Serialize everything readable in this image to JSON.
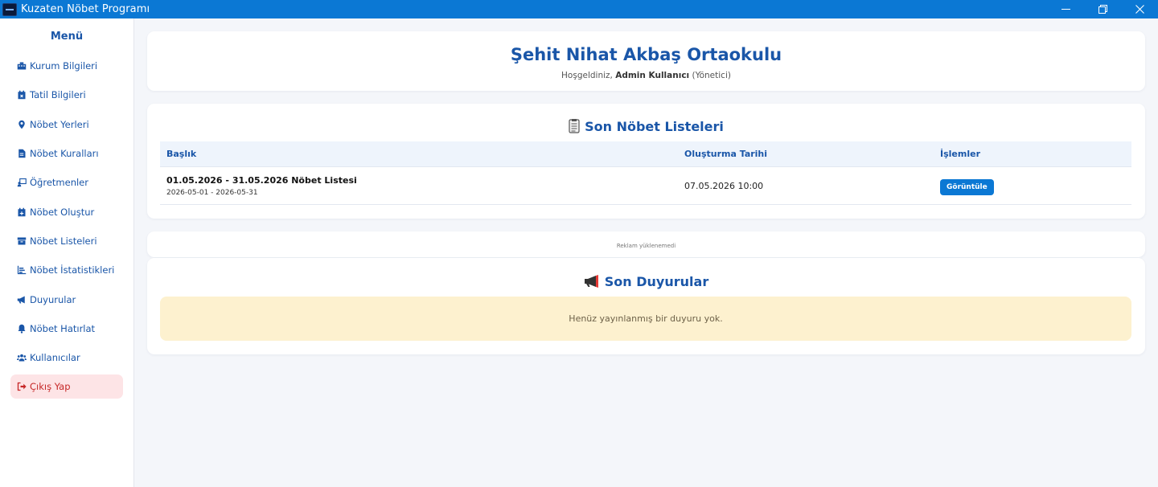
{
  "window": {
    "title": "Kuzaten Nöbet Programı"
  },
  "sidebar": {
    "title": "Menü",
    "items": [
      {
        "label": "Kurum Bilgileri",
        "icon": "building-icon"
      },
      {
        "label": "Tatil Bilgileri",
        "icon": "calendar-x-icon"
      },
      {
        "label": "Nöbet Yerleri",
        "icon": "map-pin-icon"
      },
      {
        "label": "Nöbet Kuralları",
        "icon": "file-icon"
      },
      {
        "label": "Öğretmenler",
        "icon": "teacher-icon"
      },
      {
        "label": "Nöbet Oluştur",
        "icon": "calendar-plus-icon"
      },
      {
        "label": "Nöbet Listeleri",
        "icon": "archive-icon"
      },
      {
        "label": "Nöbet İstatistikleri",
        "icon": "chart-icon"
      },
      {
        "label": "Duyurular",
        "icon": "megaphone-icon"
      },
      {
        "label": "Nöbet Hatırlat",
        "icon": "bell-icon"
      },
      {
        "label": "Kullanıcılar",
        "icon": "users-icon"
      }
    ],
    "logout": {
      "label": "Çıkış Yap",
      "icon": "sign-out-icon"
    }
  },
  "header": {
    "school_name": "Şehit Nihat Akbaş Ortaokulu",
    "welcome_prefix": "Hoşgeldiniz,",
    "user_name": "Admin Kullanıcı",
    "role": "(Yönetici)"
  },
  "recent_lists": {
    "title": "Son Nöbet Listeleri",
    "columns": {
      "title": "Başlık",
      "created": "Oluşturma Tarihi",
      "actions": "İşlemler"
    },
    "rows": [
      {
        "title": "01.05.2026 - 31.05.2026 Nöbet Listesi",
        "range": "2026-05-01 - 2026-05-31",
        "created": "07.05.2026 10:00",
        "action_label": "Görüntüle"
      }
    ]
  },
  "ad": {
    "text": "Reklam yüklenemedi"
  },
  "announcements": {
    "title": "Son Duyurular",
    "empty_text": "Henüz yayınlanmış bir duyuru yok."
  },
  "colors": {
    "titlebar": "#0b78d4",
    "accent": "#1a56a8",
    "logout_bg": "#fde4e6",
    "logout_text": "#c62828",
    "notice_bg": "#fdf1cf"
  }
}
